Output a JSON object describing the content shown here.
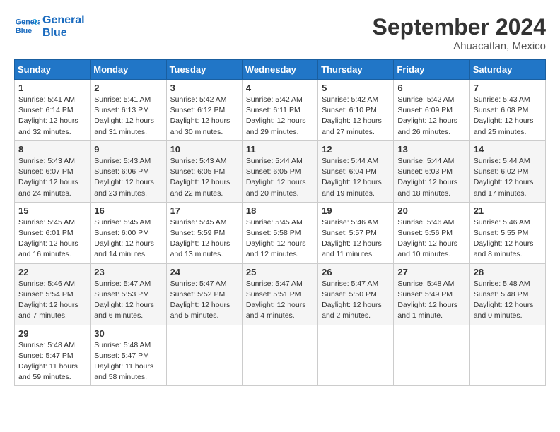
{
  "logo": {
    "line1": "General",
    "line2": "Blue"
  },
  "title": "September 2024",
  "location": "Ahuacatlan, Mexico",
  "weekdays": [
    "Sunday",
    "Monday",
    "Tuesday",
    "Wednesday",
    "Thursday",
    "Friday",
    "Saturday"
  ],
  "weeks": [
    [
      {
        "day": "1",
        "sunrise": "5:41 AM",
        "sunset": "6:14 PM",
        "daylight": "12 hours and 32 minutes."
      },
      {
        "day": "2",
        "sunrise": "5:41 AM",
        "sunset": "6:13 PM",
        "daylight": "12 hours and 31 minutes."
      },
      {
        "day": "3",
        "sunrise": "5:42 AM",
        "sunset": "6:12 PM",
        "daylight": "12 hours and 30 minutes."
      },
      {
        "day": "4",
        "sunrise": "5:42 AM",
        "sunset": "6:11 PM",
        "daylight": "12 hours and 29 minutes."
      },
      {
        "day": "5",
        "sunrise": "5:42 AM",
        "sunset": "6:10 PM",
        "daylight": "12 hours and 27 minutes."
      },
      {
        "day": "6",
        "sunrise": "5:42 AM",
        "sunset": "6:09 PM",
        "daylight": "12 hours and 26 minutes."
      },
      {
        "day": "7",
        "sunrise": "5:43 AM",
        "sunset": "6:08 PM",
        "daylight": "12 hours and 25 minutes."
      }
    ],
    [
      {
        "day": "8",
        "sunrise": "5:43 AM",
        "sunset": "6:07 PM",
        "daylight": "12 hours and 24 minutes."
      },
      {
        "day": "9",
        "sunrise": "5:43 AM",
        "sunset": "6:06 PM",
        "daylight": "12 hours and 23 minutes."
      },
      {
        "day": "10",
        "sunrise": "5:43 AM",
        "sunset": "6:05 PM",
        "daylight": "12 hours and 22 minutes."
      },
      {
        "day": "11",
        "sunrise": "5:44 AM",
        "sunset": "6:05 PM",
        "daylight": "12 hours and 20 minutes."
      },
      {
        "day": "12",
        "sunrise": "5:44 AM",
        "sunset": "6:04 PM",
        "daylight": "12 hours and 19 minutes."
      },
      {
        "day": "13",
        "sunrise": "5:44 AM",
        "sunset": "6:03 PM",
        "daylight": "12 hours and 18 minutes."
      },
      {
        "day": "14",
        "sunrise": "5:44 AM",
        "sunset": "6:02 PM",
        "daylight": "12 hours and 17 minutes."
      }
    ],
    [
      {
        "day": "15",
        "sunrise": "5:45 AM",
        "sunset": "6:01 PM",
        "daylight": "12 hours and 16 minutes."
      },
      {
        "day": "16",
        "sunrise": "5:45 AM",
        "sunset": "6:00 PM",
        "daylight": "12 hours and 14 minutes."
      },
      {
        "day": "17",
        "sunrise": "5:45 AM",
        "sunset": "5:59 PM",
        "daylight": "12 hours and 13 minutes."
      },
      {
        "day": "18",
        "sunrise": "5:45 AM",
        "sunset": "5:58 PM",
        "daylight": "12 hours and 12 minutes."
      },
      {
        "day": "19",
        "sunrise": "5:46 AM",
        "sunset": "5:57 PM",
        "daylight": "12 hours and 11 minutes."
      },
      {
        "day": "20",
        "sunrise": "5:46 AM",
        "sunset": "5:56 PM",
        "daylight": "12 hours and 10 minutes."
      },
      {
        "day": "21",
        "sunrise": "5:46 AM",
        "sunset": "5:55 PM",
        "daylight": "12 hours and 8 minutes."
      }
    ],
    [
      {
        "day": "22",
        "sunrise": "5:46 AM",
        "sunset": "5:54 PM",
        "daylight": "12 hours and 7 minutes."
      },
      {
        "day": "23",
        "sunrise": "5:47 AM",
        "sunset": "5:53 PM",
        "daylight": "12 hours and 6 minutes."
      },
      {
        "day": "24",
        "sunrise": "5:47 AM",
        "sunset": "5:52 PM",
        "daylight": "12 hours and 5 minutes."
      },
      {
        "day": "25",
        "sunrise": "5:47 AM",
        "sunset": "5:51 PM",
        "daylight": "12 hours and 4 minutes."
      },
      {
        "day": "26",
        "sunrise": "5:47 AM",
        "sunset": "5:50 PM",
        "daylight": "12 hours and 2 minutes."
      },
      {
        "day": "27",
        "sunrise": "5:48 AM",
        "sunset": "5:49 PM",
        "daylight": "12 hours and 1 minute."
      },
      {
        "day": "28",
        "sunrise": "5:48 AM",
        "sunset": "5:48 PM",
        "daylight": "12 hours and 0 minutes."
      }
    ],
    [
      {
        "day": "29",
        "sunrise": "5:48 AM",
        "sunset": "5:47 PM",
        "daylight": "11 hours and 59 minutes."
      },
      {
        "day": "30",
        "sunrise": "5:48 AM",
        "sunset": "5:47 PM",
        "daylight": "11 hours and 58 minutes."
      },
      null,
      null,
      null,
      null,
      null
    ]
  ]
}
